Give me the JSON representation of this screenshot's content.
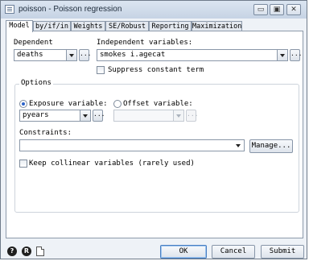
{
  "window": {
    "title": "poisson - Poisson regression",
    "controls": {
      "minimize": "▭",
      "restore": "▣",
      "close": "✕"
    }
  },
  "tabs": [
    "Model",
    "by/if/in",
    "Weights",
    "SE/Robust",
    "Reporting",
    "Maximization"
  ],
  "model": {
    "dependent_label": "Dependent",
    "dependent_value": "deaths",
    "independent_label": "Independent variables:",
    "independent_value": "smokes i.agecat",
    "suppress_label": "Suppress constant term",
    "options_label": "Options",
    "exposure_label": "Exposure variable:",
    "exposure_value": "pyears",
    "offset_label": "Offset variable:",
    "offset_value": "",
    "constraints_label": "Constraints:",
    "constraints_value": "",
    "manage_label": "Manage...",
    "keep_collinear_label": "Keep collinear variables (rarely used)",
    "ellipsis": "..."
  },
  "footer": {
    "help_icon": "?",
    "reset_icon": "R",
    "ok_label": "OK",
    "cancel_label": "Cancel",
    "submit_label": "Submit"
  },
  "icons": [
    "app-icon",
    "minimize-icon",
    "restore-icon",
    "close-icon",
    "help-icon",
    "reset-icon",
    "copy-command-icon"
  ]
}
